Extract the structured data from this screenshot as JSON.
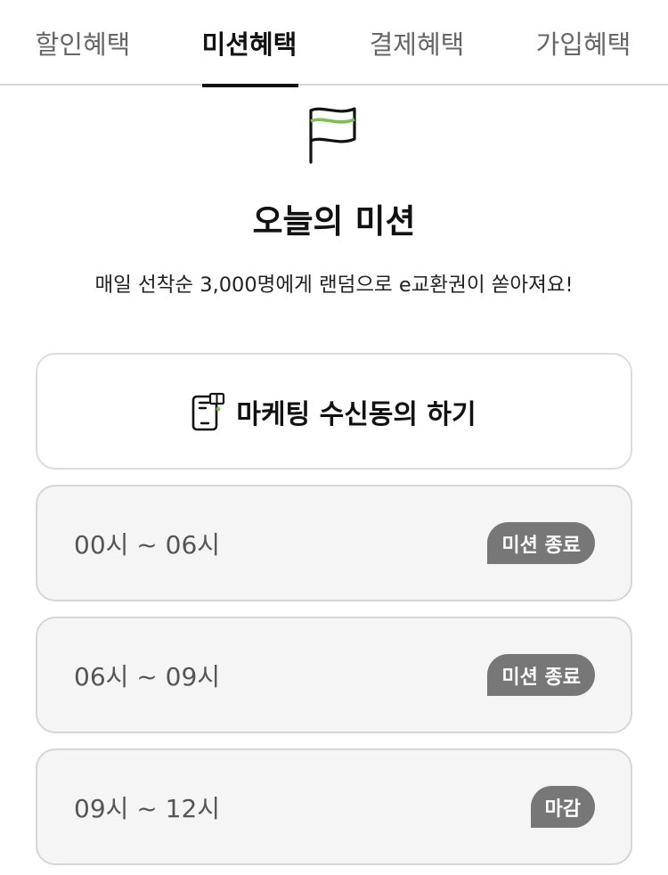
{
  "tabs": [
    {
      "label": "할인혜택",
      "active": false
    },
    {
      "label": "미션혜택",
      "active": true
    },
    {
      "label": "결제혜택",
      "active": false
    },
    {
      "label": "가입혜택",
      "active": false
    }
  ],
  "icons": {
    "flag": "flag-icon",
    "marketing": "phone-notification-icon"
  },
  "colors": {
    "accent_green": "#7cc04b",
    "badge_bg": "#777777",
    "tab_active": "#111111"
  },
  "mission": {
    "title": "오늘의 미션",
    "subtitle": "매일 선착순 3,000명에게 랜덤으로 e교환권이 쏟아져요!"
  },
  "marketing_button": {
    "label": "마케팅 수신동의 하기"
  },
  "slots": [
    {
      "time": "00시 ~ 06시",
      "status": "미션 종료"
    },
    {
      "time": "06시 ~ 09시",
      "status": "미션 종료"
    },
    {
      "time": "09시 ~ 12시",
      "status": "마감"
    }
  ]
}
